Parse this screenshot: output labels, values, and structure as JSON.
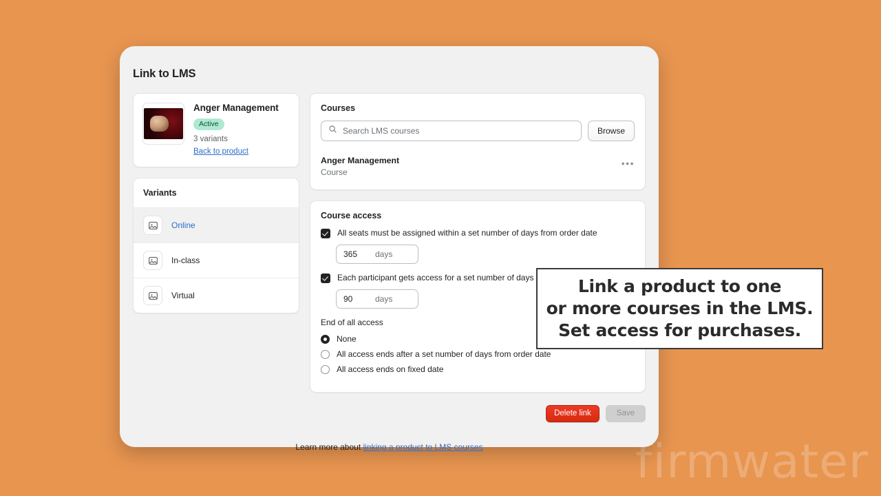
{
  "theme": {
    "background": "#e89550",
    "modal_bg": "#f1f1f1",
    "accent_link": "#2c6ecb",
    "danger": "#d82b12",
    "badge_bg": "#aee9d1",
    "badge_text": "#0c5132"
  },
  "watermark": {
    "text": "firmwater"
  },
  "modal": {
    "title": "Link to LMS"
  },
  "product": {
    "name": "Anger Management",
    "status_badge": "Active",
    "variants_count": "3 variants",
    "back_link": "Back to product",
    "thumbnail_icon": "product-thumbnail-image"
  },
  "variants": {
    "heading": "Variants",
    "items": [
      {
        "label": "Online",
        "icon": "image-placeholder-icon",
        "selected": true
      },
      {
        "label": "In-class",
        "icon": "image-placeholder-icon",
        "selected": false
      },
      {
        "label": "Virtual",
        "icon": "image-placeholder-icon",
        "selected": false
      }
    ]
  },
  "courses": {
    "heading": "Courses",
    "search_placeholder": "Search LMS courses",
    "search_value": "",
    "search_icon": "search-icon",
    "browse_label": "Browse",
    "overflow_icon": "ellipsis-horizontal-icon",
    "items": [
      {
        "name": "Anger Management",
        "type": "Course"
      }
    ]
  },
  "course_access": {
    "heading": "Course access",
    "checkboxes": [
      {
        "label": "All seats must be assigned within a set number of days from order date",
        "checked": true,
        "value": "365",
        "unit": "days"
      },
      {
        "label": "Each participant gets access for a set number of days after assignment",
        "checked": true,
        "value": "90",
        "unit": "days"
      }
    ],
    "end_of_access": {
      "label": "End of all access",
      "options": [
        {
          "label": "None",
          "selected": true
        },
        {
          "label": "All access ends after a set number of days from order date",
          "selected": false
        },
        {
          "label": "All access ends on fixed date",
          "selected": false
        }
      ]
    }
  },
  "footer": {
    "delete_label": "Delete link",
    "save_label": "Save",
    "learn_more_prefix": "Learn more about ",
    "learn_more_link": "linking a product to LMS courses"
  },
  "callout": {
    "text": "Link a product to one\nor more courses in the LMS.\nSet access for purchases."
  }
}
